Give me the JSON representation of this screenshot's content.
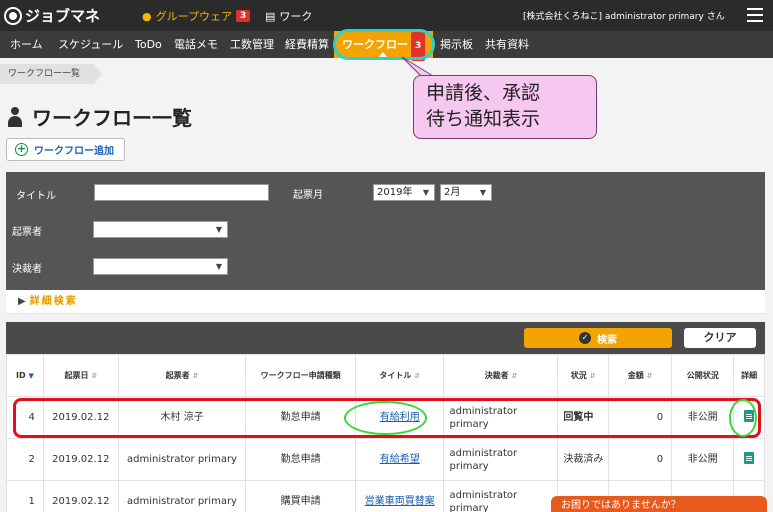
{
  "app": {
    "logo": "ジョブマネ"
  },
  "topbar": {
    "groupware_label": "グループウェア",
    "groupware_badge": "3",
    "work_label": "ワーク",
    "user": "[株式会社くろねこ] administrator primary さん"
  },
  "nav": {
    "items": [
      {
        "label": "ホーム"
      },
      {
        "label": "スケジュール"
      },
      {
        "label": "ToDo"
      },
      {
        "label": "電話メモ"
      },
      {
        "label": "工数管理"
      },
      {
        "label": "経費精算"
      },
      {
        "label": "ワークフロー",
        "badge": "3",
        "active": true
      },
      {
        "label": "掲示板"
      },
      {
        "label": "共有資料"
      }
    ]
  },
  "breadcrumb": "ワークフロー一覧",
  "page": {
    "title": "ワークフロー一覧",
    "add_button": "ワークフロー追加"
  },
  "search": {
    "title_label": "タイトル",
    "title_value": "",
    "date_label": "起票月",
    "year_value": "2019年",
    "month_value": "2月",
    "applicant_label": "起票者",
    "applicant_value": "",
    "approver_label": "決裁者",
    "approver_value": "",
    "advanced_label": "詳細検索",
    "search_button": "検索",
    "clear_button": "クリア"
  },
  "table": {
    "headers": [
      "ID",
      "起票日",
      "起票者",
      "ワークフロー申請種類",
      "タイトル",
      "決裁者",
      "状況",
      "金額",
      "公開状況",
      "詳細"
    ],
    "rows": [
      {
        "id": "4",
        "date": "2019.02.12",
        "applicant": "木村 涼子",
        "type": "勤怠申請",
        "title": "有給利用",
        "approver": "administrator primary",
        "status": "回覧中",
        "amount": "0",
        "visibility": "非公開"
      },
      {
        "id": "2",
        "date": "2019.02.12",
        "applicant": "administrator primary",
        "type": "勤怠申請",
        "title": "有給希望",
        "approver": "administrator primary",
        "status": "決裁済み",
        "amount": "0",
        "visibility": "非公開"
      },
      {
        "id": "1",
        "date": "2019.02.12",
        "applicant": "administrator primary",
        "type": "購買申請",
        "title": "営業車両買替案",
        "approver": "administrator primary",
        "status": "",
        "amount": "",
        "visibility": ""
      }
    ]
  },
  "annotation": {
    "callout": "申請後、承認\n待ち通知表示"
  },
  "help": {
    "label": "お困りではありませんか？"
  },
  "colors": {
    "accent": "#f5a300",
    "badge": "#e0322c",
    "highlight_row": "#e0101a",
    "highlight_green": "#3bd63b",
    "highlight_cyan": "#2fcfc4",
    "callout_bg": "#f6c7ef"
  }
}
